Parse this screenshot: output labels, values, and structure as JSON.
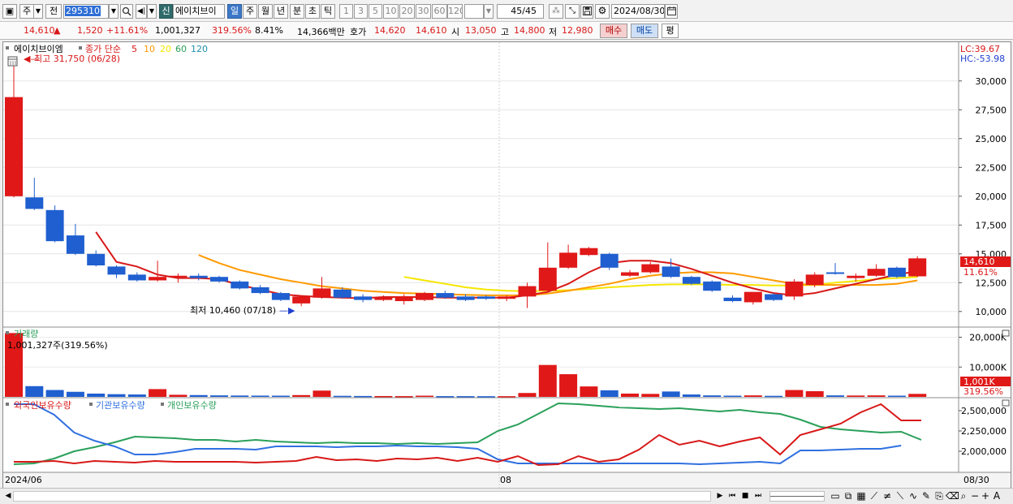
{
  "toolbar": {
    "period_label": "주",
    "prev_label": "전",
    "code_value": "295310",
    "new_badge": "신",
    "stock_name": "에이치브이",
    "period_tabs": [
      "일",
      "주",
      "월",
      "년",
      "분",
      "초",
      "틱"
    ],
    "minute_tabs": [
      "1",
      "3",
      "5",
      "10",
      "20",
      "30",
      "60",
      "120"
    ],
    "count_display": "45/45",
    "date_value": "2024/08/30"
  },
  "quote": {
    "price": "14,610",
    "arrow": "▲",
    "change": "1,520",
    "change_pct": "+11.61%",
    "volume": "1,001,327",
    "vol_ratio": "319.56%",
    "turnover": "8.41%",
    "amount": "14,366백만",
    "hoga_label": "호가",
    "ask": "14,620",
    "bid": "14,610",
    "open_label": "시",
    "open": "13,050",
    "high_label": "고",
    "high": "14,800",
    "low_label": "저",
    "low": "12,980",
    "buy_label": "매수",
    "sell_label": "매도",
    "avg_label": "평"
  },
  "price_panel": {
    "legend_name": "에이치브이엠",
    "legend_ma_label": "종가 단순",
    "ma_periods": [
      "5",
      "10",
      "20",
      "60",
      "120"
    ],
    "ma_colors": [
      "#d81818",
      "#ff9a00",
      "#f5e600",
      "#2aa05a",
      "#1f8fa8"
    ],
    "max_annotation": "최고 31,750 (06/28)",
    "min_annotation": "최저 10,460 (07/18)",
    "lc": "LC:39.67",
    "hc": "HC:-53.98",
    "yticks": [
      30000,
      27500,
      25000,
      22500,
      20000,
      17500,
      15000,
      12500,
      10000
    ],
    "ytick_labels": [
      "30,000",
      "27,500",
      "25,000",
      "22,500",
      "20,000",
      "17,500",
      "15,000",
      "12,500",
      "10,000"
    ],
    "ymin": 9000,
    "ymax": 32800,
    "price_tag": "14,610",
    "pct_tag": "11.61%"
  },
  "candles": [
    {
      "o": 20000,
      "h": 31750,
      "l": 19900,
      "c": 28600
    },
    {
      "o": 19900,
      "h": 21600,
      "l": 18800,
      "c": 18900
    },
    {
      "o": 18800,
      "h": 19200,
      "l": 16000,
      "c": 16100
    },
    {
      "o": 16600,
      "h": 17600,
      "l": 14900,
      "c": 15000
    },
    {
      "o": 15000,
      "h": 15300,
      "l": 13900,
      "c": 14000
    },
    {
      "o": 13900,
      "h": 14000,
      "l": 12900,
      "c": 13200
    },
    {
      "o": 13200,
      "h": 13400,
      "l": 12600,
      "c": 12700
    },
    {
      "o": 12700,
      "h": 14400,
      "l": 12600,
      "c": 13000
    },
    {
      "o": 13000,
      "h": 13300,
      "l": 12500,
      "c": 13100
    },
    {
      "o": 13100,
      "h": 13300,
      "l": 12700,
      "c": 12900
    },
    {
      "o": 13000,
      "h": 13100,
      "l": 12500,
      "c": 12600
    },
    {
      "o": 12600,
      "h": 12700,
      "l": 11900,
      "c": 12000
    },
    {
      "o": 12100,
      "h": 12300,
      "l": 11500,
      "c": 11600
    },
    {
      "o": 11600,
      "h": 11700,
      "l": 10900,
      "c": 11000
    },
    {
      "o": 10700,
      "h": 11400,
      "l": 10460,
      "c": 11300
    },
    {
      "o": 11200,
      "h": 13000,
      "l": 11100,
      "c": 12000
    },
    {
      "o": 11900,
      "h": 12100,
      "l": 11100,
      "c": 11200
    },
    {
      "o": 11300,
      "h": 11500,
      "l": 10800,
      "c": 11000
    },
    {
      "o": 11000,
      "h": 11400,
      "l": 10900,
      "c": 11200
    },
    {
      "o": 10900,
      "h": 11500,
      "l": 10600,
      "c": 11300
    },
    {
      "o": 11000,
      "h": 11700,
      "l": 10900,
      "c": 11600
    },
    {
      "o": 11600,
      "h": 11800,
      "l": 11100,
      "c": 11200
    },
    {
      "o": 11300,
      "h": 11500,
      "l": 10900,
      "c": 11000
    },
    {
      "o": 11300,
      "h": 11400,
      "l": 11000,
      "c": 11100
    },
    {
      "o": 11100,
      "h": 11400,
      "l": 10900,
      "c": 11300
    },
    {
      "o": 11300,
      "h": 12500,
      "l": 10300,
      "c": 12200
    },
    {
      "o": 11800,
      "h": 16000,
      "l": 11700,
      "c": 13800
    },
    {
      "o": 13800,
      "h": 15800,
      "l": 13700,
      "c": 15100
    },
    {
      "o": 14900,
      "h": 15600,
      "l": 14800,
      "c": 15500
    },
    {
      "o": 15000,
      "h": 15100,
      "l": 13600,
      "c": 13800
    },
    {
      "o": 13100,
      "h": 13600,
      "l": 13000,
      "c": 13400
    },
    {
      "o": 13400,
      "h": 14300,
      "l": 13300,
      "c": 14100
    },
    {
      "o": 13900,
      "h": 14600,
      "l": 12900,
      "c": 13000
    },
    {
      "o": 13000,
      "h": 13100,
      "l": 12300,
      "c": 12400
    },
    {
      "o": 12600,
      "h": 12700,
      "l": 11700,
      "c": 11800
    },
    {
      "o": 11200,
      "h": 11400,
      "l": 10800,
      "c": 10900
    },
    {
      "o": 10800,
      "h": 11600,
      "l": 10600,
      "c": 11700
    },
    {
      "o": 11500,
      "h": 11600,
      "l": 10900,
      "c": 11000
    },
    {
      "o": 11300,
      "h": 12800,
      "l": 11000,
      "c": 12600
    },
    {
      "o": 12300,
      "h": 13400,
      "l": 12100,
      "c": 13200
    },
    {
      "o": 13400,
      "h": 14200,
      "l": 13200,
      "c": 13300
    },
    {
      "o": 12900,
      "h": 13300,
      "l": 12600,
      "c": 13100
    },
    {
      "o": 13100,
      "h": 14100,
      "l": 13000,
      "c": 13700
    },
    {
      "o": 13800,
      "h": 13900,
      "l": 12900,
      "c": 13000
    },
    {
      "o": 13050,
      "h": 14800,
      "l": 12980,
      "c": 14610
    }
  ],
  "ma5": [
    null,
    null,
    null,
    null,
    16900,
    14300,
    13900,
    13200,
    12900,
    12900,
    12800,
    12300,
    11900,
    11500,
    11350,
    11250,
    11200,
    11150,
    11250,
    11250,
    11250,
    11200,
    11200,
    11200,
    11200,
    11400,
    11700,
    12400,
    13400,
    14200,
    14400,
    14400,
    14200,
    13700,
    13100,
    12500,
    12000,
    11600,
    11400,
    11600,
    12000,
    12400,
    12800,
    13200,
    13500
  ],
  "ma10": [
    null,
    null,
    null,
    null,
    null,
    null,
    null,
    null,
    null,
    14900,
    14200,
    13600,
    13200,
    12800,
    12500,
    12200,
    12000,
    11800,
    11700,
    11600,
    11550,
    11500,
    11450,
    11400,
    11400,
    11400,
    11550,
    11800,
    12100,
    12400,
    12800,
    13100,
    13300,
    13400,
    13400,
    13300,
    13000,
    12700,
    12400,
    12300,
    12300,
    12300,
    12300,
    12400,
    12700
  ],
  "ma20": [
    null,
    null,
    null,
    null,
    null,
    null,
    null,
    null,
    null,
    null,
    null,
    null,
    null,
    null,
    null,
    null,
    null,
    null,
    null,
    13000,
    12700,
    12400,
    12100,
    11900,
    11800,
    11750,
    11800,
    11850,
    11950,
    12100,
    12200,
    12300,
    12350,
    12350,
    12350,
    12300,
    12300,
    12250,
    12250,
    12300,
    12500,
    12650,
    12800,
    12900,
    13000
  ],
  "volume_panel": {
    "legend": "거래량",
    "info": "1,001,327주(319.56%)",
    "yticks": [
      20000,
      10000
    ],
    "ytick_labels": [
      "20,000K",
      "10,000K"
    ],
    "ymax": 21500,
    "tag": "1,001K",
    "tag_pct": "319.56%"
  },
  "volumes_k": [
    21400,
    3600,
    2300,
    1700,
    1100,
    900,
    800,
    2600,
    700,
    600,
    500,
    450,
    420,
    400,
    600,
    2100,
    350,
    300,
    280,
    250,
    400,
    250,
    240,
    220,
    230,
    1300,
    10700,
    7600,
    3500,
    2200,
    1100,
    1000,
    1800,
    800,
    500,
    400,
    500,
    350,
    2300,
    1900,
    500,
    450,
    500,
    400,
    1001
  ],
  "holders_panel": {
    "legend": [
      "외국인보유수량",
      "기관보유수량",
      "개인보유수량"
    ],
    "colors": [
      "#d81818",
      "#3070e0",
      "#2aa05a"
    ],
    "yticks": [
      2500000,
      2250000,
      2000000
    ],
    "ytick_labels": [
      "2,500,000",
      "2,250,000",
      "2,000,000"
    ],
    "ymin": 1750000,
    "ymax": 2620000
  },
  "foreign": [
    1870000,
    1870000,
    1880000,
    1850000,
    1880000,
    1870000,
    1860000,
    1880000,
    1870000,
    1870000,
    1870000,
    1870000,
    1860000,
    1870000,
    1880000,
    1930000,
    1890000,
    1900000,
    1880000,
    1910000,
    1900000,
    1920000,
    1880000,
    1920000,
    1870000,
    1940000,
    1830000,
    1840000,
    1940000,
    1870000,
    1900000,
    2020000,
    2200000,
    2080000,
    2130000,
    2060000,
    2120000,
    2170000,
    1960000,
    2200000,
    2270000,
    2340000,
    2480000,
    2580000,
    2380000,
    2380000
  ],
  "institution": [
    2580000,
    2580000,
    2450000,
    2230000,
    2130000,
    2060000,
    1960000,
    1960000,
    1990000,
    2030000,
    2030000,
    2030000,
    2020000,
    2060000,
    2060000,
    2060000,
    2050000,
    2060000,
    2060000,
    2070000,
    2060000,
    2060000,
    2050000,
    2030000,
    1900000,
    1850000,
    1850000,
    1850000,
    1850000,
    1850000,
    1850000,
    1850000,
    1850000,
    1850000,
    1840000,
    1850000,
    1860000,
    1870000,
    1850000,
    2010000,
    2010000,
    2020000,
    2030000,
    2030000,
    2070000
  ],
  "individual": [
    1840000,
    1850000,
    1910000,
    2000000,
    2050000,
    2110000,
    2180000,
    2170000,
    2160000,
    2140000,
    2140000,
    2120000,
    2140000,
    2120000,
    2110000,
    2100000,
    2110000,
    2100000,
    2100000,
    2090000,
    2100000,
    2090000,
    2100000,
    2110000,
    2250000,
    2330000,
    2460000,
    2590000,
    2580000,
    2560000,
    2540000,
    2530000,
    2520000,
    2530000,
    2510000,
    2490000,
    2510000,
    2480000,
    2460000,
    2390000,
    2300000,
    2270000,
    2250000,
    2230000,
    2240000,
    2140000
  ],
  "axis": {
    "start_label": "2024/06",
    "mid_label": "08",
    "end_label": "08/30"
  },
  "statusbar": {
    "icons": [
      "▶",
      "⏮",
      "■",
      "⏭"
    ]
  }
}
